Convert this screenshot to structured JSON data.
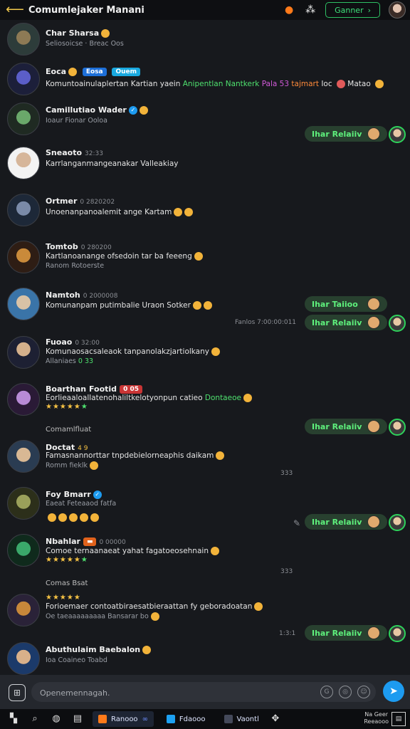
{
  "header": {
    "title": "Comumlejaker Manani",
    "button_label": "Ganner",
    "button_arrow": "›"
  },
  "messages": [
    {
      "name": "Char Sharsa",
      "sub": "Seliosoicse · Breac Oos"
    },
    {
      "name": "Eoca",
      "badge1": "Eosa",
      "badge2": "Ouem",
      "text_a": "Komuntoainulaplertan Kartian yaein",
      "text_green": "Anipentlan Nantkerk",
      "text_violet": "Pala 53",
      "text_orange": "tajmart",
      "text_d": "Ioc",
      "text_e": "Matao"
    },
    {
      "name": "Camillutiao Wader",
      "sub": "Ioaur Fionar Ooloa"
    },
    {
      "name": "Sneaoto",
      "time": "32:33",
      "text": "Karrlanganmangeanakar Valleakiay"
    },
    {
      "name": "Ortmer",
      "time": "0 2820202",
      "text": "Unoenanpanoalemit ange Kartam"
    },
    {
      "name": "Tomtob",
      "time": "0 280200",
      "text": "Kartlanoanange ofsedoin tar ba feeeng",
      "sub": "Ranom Rotoerste"
    },
    {
      "name": "Namtoh",
      "time": "0 2000008",
      "text": "Komunanpam putimbalie Uraon Sotker"
    },
    {
      "name": "Fuoao",
      "time": "0 32:00",
      "text": "Komunaosacsaleaok tanpanolakzjartiolkany",
      "sub": "Allaniaes",
      "sub2": "0 33"
    },
    {
      "name": "Boarthan Footid",
      "badge": "0 05",
      "text_a": "Eorlieaaloallatenohaliltkelotyonpun catieo",
      "text_green": "Dontaeoe"
    },
    {
      "name": "Doctat",
      "time": "4 9",
      "text": "Famasnannorttar tnpdebielorneaphis daikam",
      "sub": "Romm fieklk"
    },
    {
      "name": "Foy Bmarr",
      "sub": "Eaeat Feteaaod fatfa"
    },
    {
      "name": "Nbahlar",
      "time": "0 00000",
      "text": "Comoe ternaanaeat yahat fagatoeosehnain"
    },
    {
      "name": "",
      "text": "Forioemaer contoatbiraesatbieraattan fy geboradoatan",
      "sub": "Oe taeaaaaaaaaa Bansarar bo"
    },
    {
      "name": "Abuthulaim Baebalon",
      "sub": "Ioa Coaineo Toabd"
    }
  ],
  "date_labels": [
    "Comamlfluat",
    "Comas Bsat"
  ],
  "side_notes": [
    "Fanlos 7:00:00:011",
    "333",
    "333",
    "333",
    "1:3:1"
  ],
  "replies": [
    {
      "label": "Ihar Relaiiv"
    },
    {
      "label": "Ihar Taiioo"
    },
    {
      "label": "Ihar Relaiiv"
    },
    {
      "label": "Ihar Relaiiv"
    },
    {
      "label": "Ihar Relaiiv"
    },
    {
      "label": "Ihar Relaiiv"
    }
  ],
  "composer": {
    "placeholder": "Openemennagah."
  },
  "taskbar": {
    "app1": "Ranooo",
    "app2": "Fdaooo",
    "app3": "Vaontl",
    "right_top": "Na Geer",
    "right_bottom": "Reeaooo"
  },
  "colors": {
    "accent_green": "#3ee07a",
    "accent_blue": "#1d9bf0",
    "bg": "#17191d"
  }
}
